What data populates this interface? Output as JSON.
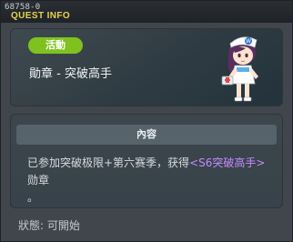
{
  "window": {
    "quest_id": "68758-0",
    "title": "QUEST INFO"
  },
  "header": {
    "badge": "活動",
    "quest_name": "勛章 - 突破高手"
  },
  "content": {
    "section_title": "內容",
    "description_prefix": "已参加突破极限+第六赛季，获得",
    "highlight": "<S6突破高手>",
    "description_suffix": "勋章",
    "description_end": "。"
  },
  "status": "狀態: 可開始",
  "colors": {
    "title": "#e7d34a",
    "badge": "#7fc21f",
    "highlight": "#c48bff"
  }
}
